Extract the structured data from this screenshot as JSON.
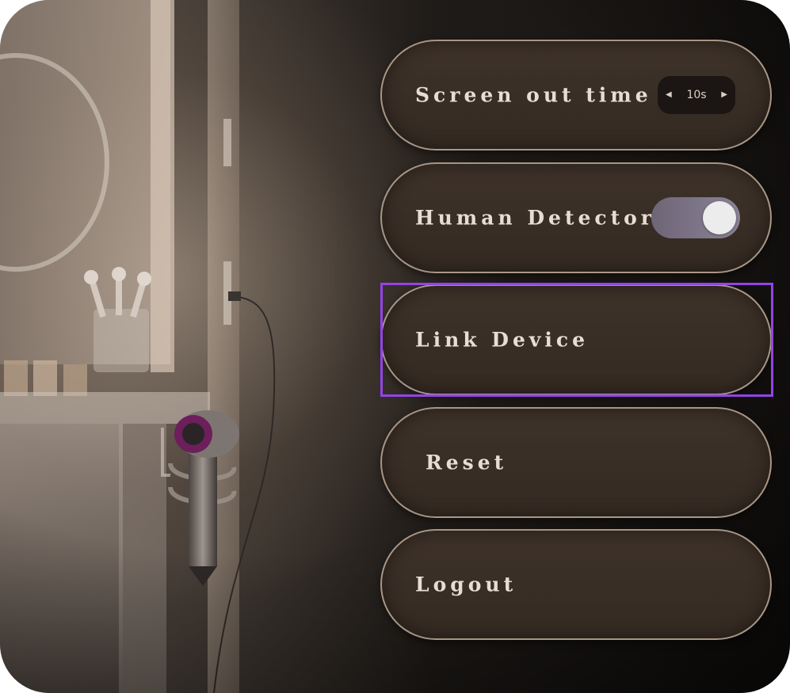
{
  "settings": {
    "screen_out_time": {
      "label": "Screen out time",
      "value": "10s",
      "decrease_icon": "triangle-left-icon",
      "increase_icon": "triangle-right-icon"
    },
    "human_detector": {
      "label": "Human Detector",
      "enabled": true
    },
    "link_device": {
      "label": "Link Device",
      "focused": true
    },
    "reset": {
      "label": "Reset"
    },
    "logout": {
      "label": "Logout"
    }
  },
  "colors": {
    "focus_ring": "#9244e6",
    "pill_fill": "#3a2f27",
    "pill_border": "#cdb9a5",
    "label_text": "#e7ddd3",
    "toggle_track": "#7d7589",
    "toggle_knob": "#ececec"
  }
}
